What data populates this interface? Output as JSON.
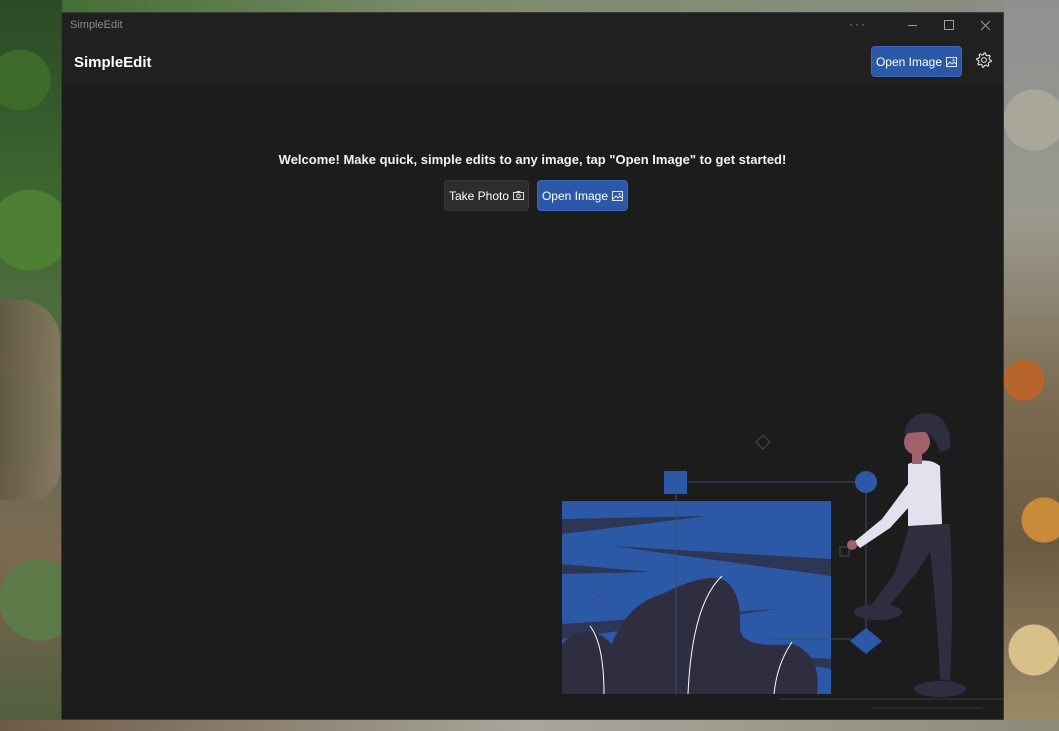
{
  "window": {
    "title": "SimpleEdit",
    "more_label": "···"
  },
  "appbar": {
    "app_name": "SimpleEdit",
    "open_image_label": "Open Image"
  },
  "main": {
    "welcome_text": "Welcome! Make quick, simple edits to any image, tap \"Open Image\" to get started!",
    "take_photo_label": "Take Photo",
    "open_image_label": "Open Image"
  },
  "icons": {
    "photo": "image-icon",
    "camera": "camera-icon",
    "settings": "gear-icon"
  },
  "colors": {
    "accent": "#2c58a8",
    "window_bg": "#1c1c1c",
    "illustration_blue": "#2c58a8",
    "illustration_dark": "#2f2e41"
  }
}
